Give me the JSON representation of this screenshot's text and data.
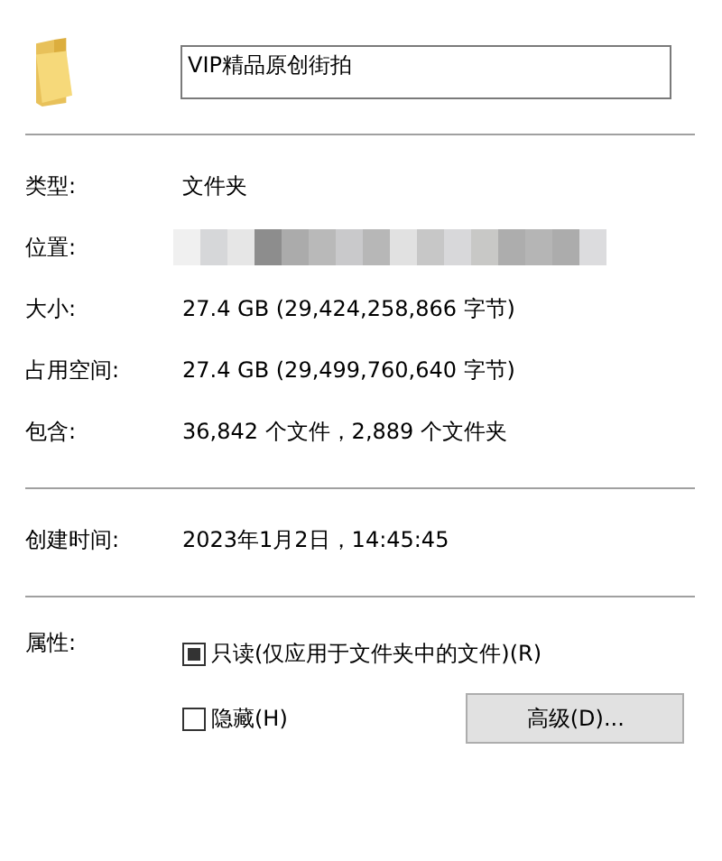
{
  "name_field": {
    "value": "VIP精品原创街拍"
  },
  "rows": [
    {
      "label": "类型:",
      "value": "文件夹"
    },
    {
      "label": "位置:",
      "redacted": true
    },
    {
      "label": "大小:",
      "value": "27.4 GB (29,424,258,866 字节)"
    },
    {
      "label": "占用空间:",
      "value": "27.4 GB (29,499,760,640 字节)"
    },
    {
      "label": "包含:",
      "value": "36,842 个文件，2,889 个文件夹"
    }
  ],
  "created": {
    "label": "创建时间:",
    "value": "2023年1月2日，14:45:45"
  },
  "attributes": {
    "label": "属性:",
    "checkboxes": [
      {
        "label": "只读(仅应用于文件夹中的文件)(R)",
        "checked": false,
        "indeterminate": true
      },
      {
        "label": "隐藏(H)",
        "checked": false,
        "indeterminate": false
      }
    ],
    "button": "高级(D)..."
  }
}
